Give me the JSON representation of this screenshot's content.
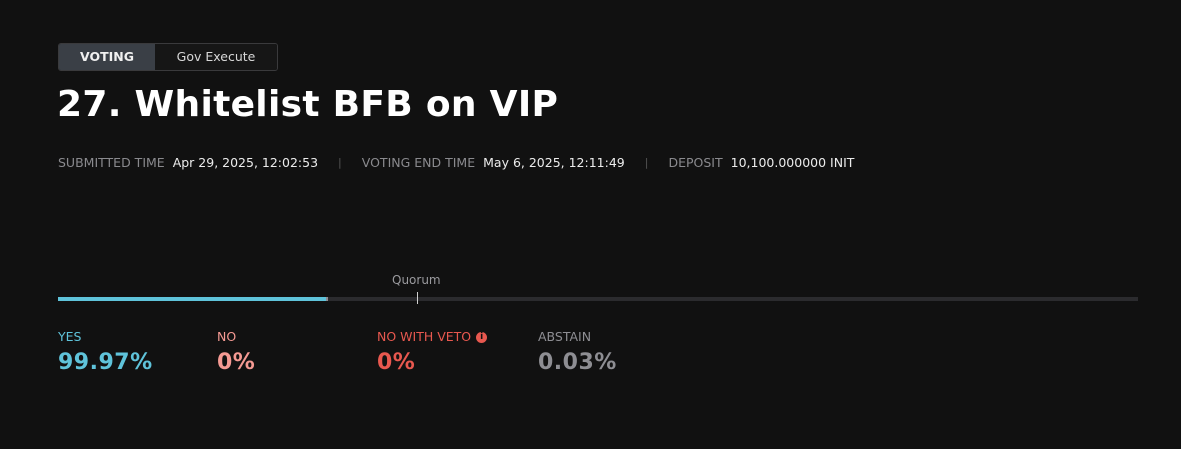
{
  "tabs": [
    {
      "label": "VOTING",
      "active": true
    },
    {
      "label": "Gov Execute",
      "active": false
    }
  ],
  "proposal": {
    "title": "27. Whitelist BFB on VIP"
  },
  "meta": {
    "submitted_label": "SUBMITTED TIME",
    "submitted_value": "Apr 29, 2025, 12:02:53",
    "voting_end_label": "VOTING END TIME",
    "voting_end_value": "May 6, 2025, 12:11:49",
    "deposit_label": "DEPOSIT",
    "deposit_value": "10,100.000000 INIT",
    "separator": "|"
  },
  "tally": {
    "quorum_label": "Quorum",
    "yes_fraction": 0.248,
    "abstain_fraction": 0.0015,
    "yes": {
      "label": "YES",
      "value": "99.97%",
      "color": "#5fc3da"
    },
    "no": {
      "label": "NO",
      "value": "0%",
      "color": "#f59a93"
    },
    "no_with_veto": {
      "label": "NO WITH VETO",
      "value": "0%",
      "color": "#e8584f",
      "icon": "info-icon"
    },
    "abstain": {
      "label": "ABSTAIN",
      "value": "0.03%",
      "color": "#8e8e93"
    }
  },
  "colors": {
    "background": "#111111",
    "bar_track": "#2b2b2e",
    "accent": "#5fc3da"
  }
}
